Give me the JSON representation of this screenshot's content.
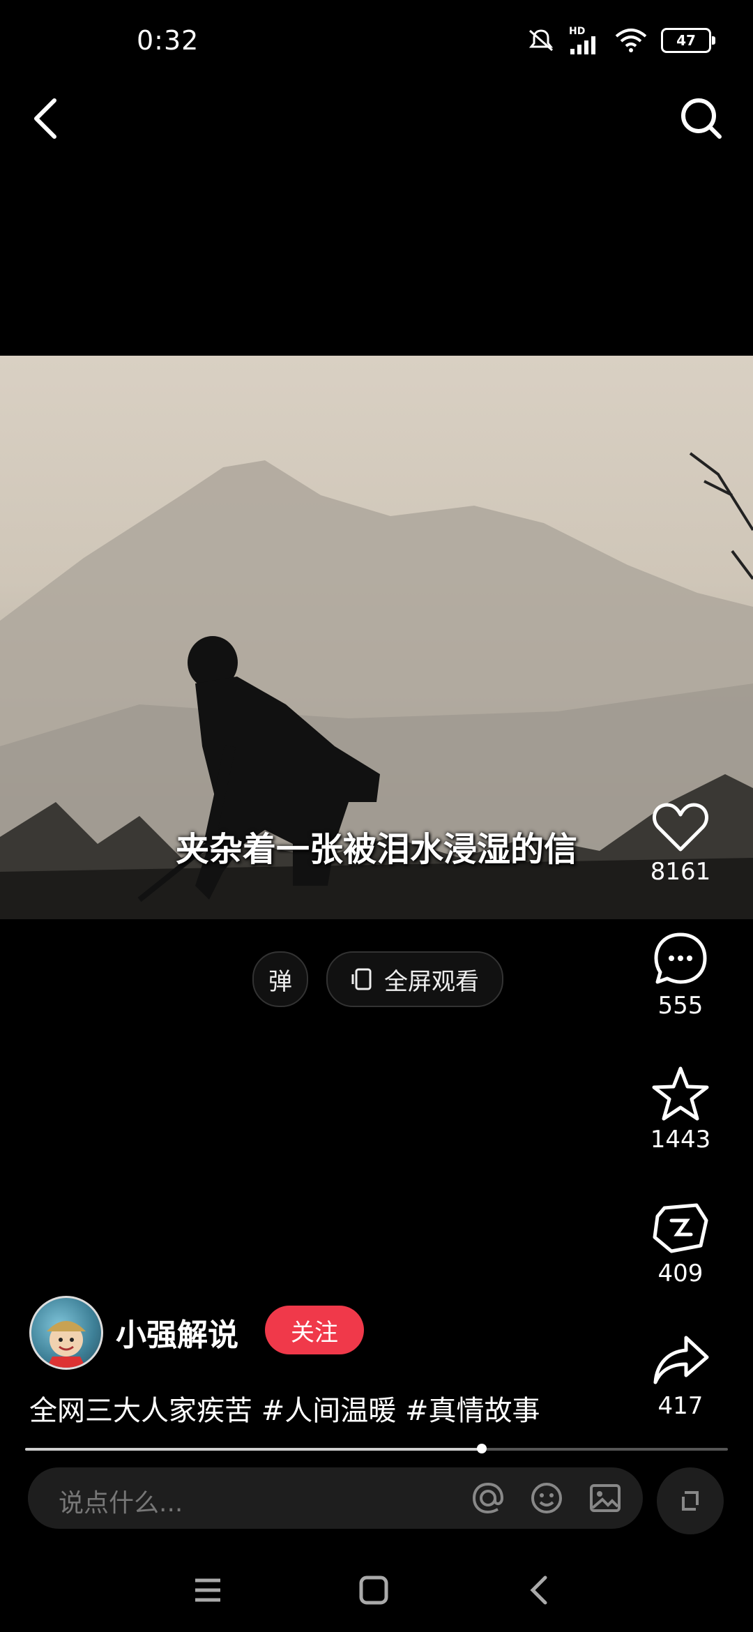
{
  "status_bar": {
    "time": "0:32",
    "battery": "47",
    "signal_label": "HD"
  },
  "video": {
    "subtitle": "夹杂着一张被泪水浸湿的信"
  },
  "controls": {
    "danmaku_label": "弹",
    "fullscreen_label": "全屏观看"
  },
  "rail": {
    "likes": "8161",
    "comments": "555",
    "favorites": "1443",
    "coins": "409",
    "shares": "417"
  },
  "author": {
    "name": "小强解说",
    "follow_label": "关注"
  },
  "caption": "全网三大人家疾苦 #人间温暖 #真情故事",
  "progress": {
    "fraction": 0.65
  },
  "comment": {
    "placeholder": "说点什么..."
  },
  "icons": [
    "back-icon",
    "search-icon",
    "heart-icon",
    "comment-icon",
    "star-icon",
    "coin-icon",
    "share-icon",
    "at-icon",
    "emoji-icon",
    "image-icon",
    "expand-icon",
    "menu-icon",
    "home-icon",
    "nav-back-icon"
  ],
  "colors": {
    "follow": "#f0394a",
    "background": "#000000"
  }
}
